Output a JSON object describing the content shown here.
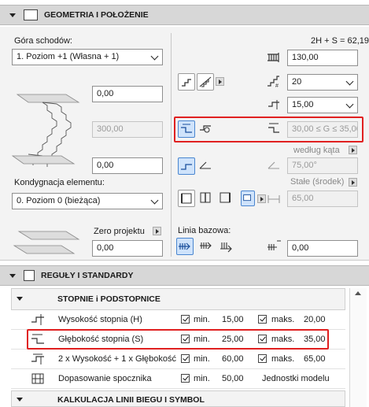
{
  "geometry": {
    "header": "GEOMETRIA I POŁOŻENIE",
    "top_label": "Góra schodów:",
    "top_select": "1. Poziom +1 (Własna + 1)",
    "formula": "2H + S = 62,19",
    "top_offset": "0,00",
    "height_dis": "300,00",
    "bottom_offset": "0,00",
    "storey_label": "Kondygnacja elementu:",
    "storey_select": "0. Poziom 0 (bieżąca)",
    "zero_label": "Zero projektu",
    "zero_value": "0,00",
    "total_height": "130,00",
    "risers_select": "20",
    "riser_height_select": "15,00",
    "going_range": "30,00 ≤ G ≤ 35,00",
    "by_angle": "według kąta",
    "angle_value": "75,00°",
    "const_label": "Stałe (środek)",
    "width_value": "65,00",
    "baseline_label": "Linia bazowa:",
    "baseline_offset": "0,00"
  },
  "rules": {
    "header": "REGUŁY I STANDARDY",
    "subheader": "STOPNIE i PODSTOPNICE",
    "rows": [
      {
        "label": "Wysokość stopnia (H)",
        "min_label": "min.",
        "min": "15,00",
        "max_label": "maks.",
        "max": "20,00"
      },
      {
        "label": "Głębokość stopnia (S)",
        "min_label": "min.",
        "min": "25,00",
        "max_label": "maks.",
        "max": "35,00"
      },
      {
        "label": "2 x Wysokość + 1 x Głębokość",
        "min_label": "min.",
        "min": "60,00",
        "max_label": "maks.",
        "max": "65,00"
      },
      {
        "label": "Dopasowanie spocznika",
        "min_label": "min.",
        "min": "50,00",
        "max_label": "Jednostki modelu",
        "max": ""
      }
    ],
    "footer": "KALKULACJA LINII BIEGU I SYMBOL"
  },
  "colors": {
    "highlight": "#e02020",
    "selected": "#cfe3fb"
  }
}
